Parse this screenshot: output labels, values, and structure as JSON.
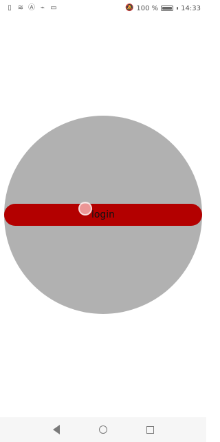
{
  "status_bar": {
    "time": "14:33",
    "battery_text": "100 %",
    "battery_level": 1.0,
    "icons_left": [
      "sim-icon",
      "wifi-icon",
      "nfc-icon",
      "usb-icon",
      "card-icon"
    ],
    "icons_right": [
      "mute-icon",
      "battery-icon"
    ]
  },
  "main": {
    "login_label": "login"
  },
  "navigation": {
    "back_icon": "back-icon",
    "home_icon": "home-icon",
    "recent_icon": "recent-apps-icon"
  },
  "colors": {
    "circle": "#b1b1b1",
    "button": "#b30000",
    "background": "#ffffff"
  }
}
